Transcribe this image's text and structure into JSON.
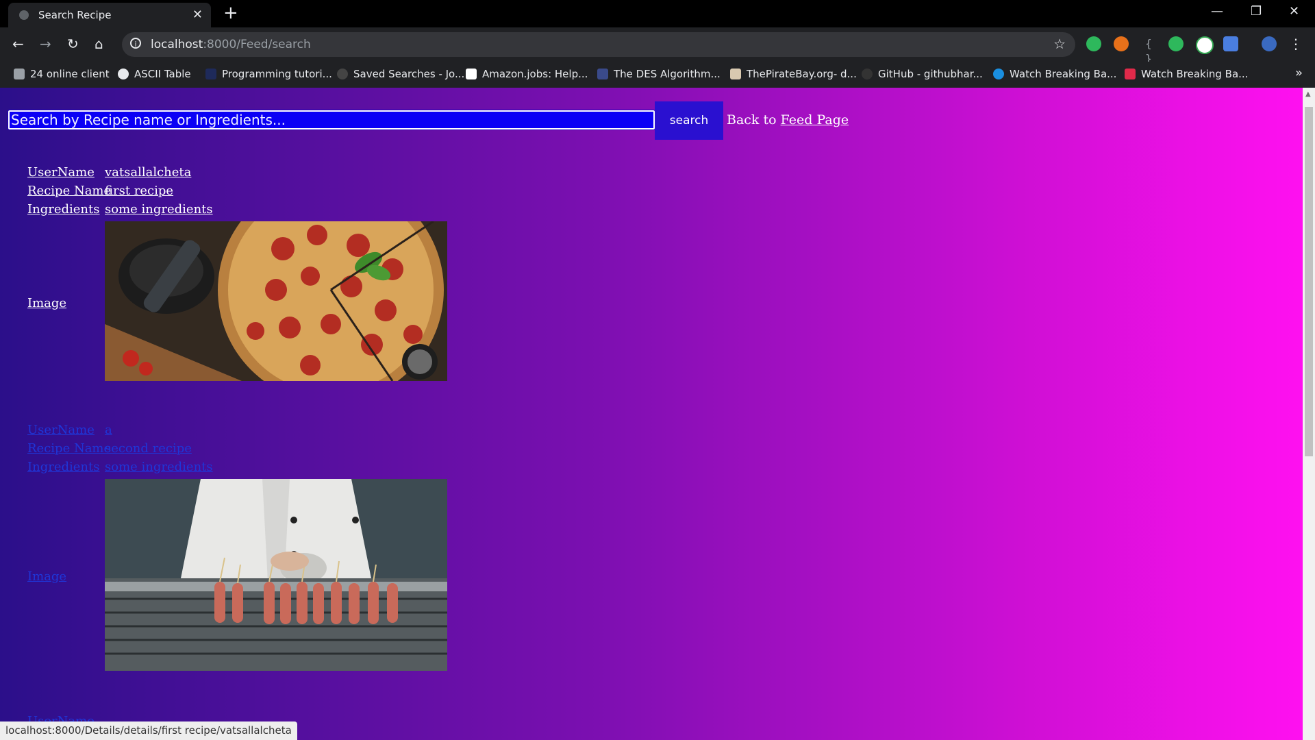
{
  "browser": {
    "tab_title": "Search Recipe",
    "new_tab": "+",
    "url_host": "localhost",
    "url_rest": ":8000/Feed/search",
    "bookmarks": [
      {
        "label": "24 online client",
        "icon_color": "#9aa0a6"
      },
      {
        "label": "ASCII Table",
        "icon_color": "#e8eaed"
      },
      {
        "label": "Programming tutori...",
        "icon_color": "#1e2a5a"
      },
      {
        "label": "Saved Searches - Jo...",
        "icon_color": "#444444"
      },
      {
        "label": "Amazon.jobs: Help...",
        "icon_color": "#ffffff"
      },
      {
        "label": "The DES Algorithm...",
        "icon_color": "#3a4a8a"
      },
      {
        "label": "ThePirateBay.org- d...",
        "icon_color": "#d9c9b0"
      },
      {
        "label": "GitHub - githubhar...",
        "icon_color": "#333333"
      },
      {
        "label": "Watch Breaking Ba...",
        "icon_color": "#1a8fe0"
      },
      {
        "label": "Watch Breaking Ba...",
        "icon_color": "#e02a4a"
      }
    ],
    "status_url": "localhost:8000/Details/details/first recipe/vatsallalcheta"
  },
  "page": {
    "search_placeholder": "Search by Recipe name or Ingredients...",
    "search_button": "search",
    "back_prefix": "Back to",
    "back_link": "Feed Page"
  },
  "labels": {
    "username": "UserName",
    "recipe_name": "Recipe Name",
    "ingredients": "Ingredients",
    "image": "Image"
  },
  "recipes": [
    {
      "username": "vatsallalcheta",
      "recipe_name": "first recipe",
      "ingredients": "some ingredients",
      "image_desc": "pizza"
    },
    {
      "username": "a",
      "recipe_name": "second recipe",
      "ingredients": "some ingredients",
      "image_desc": "grill"
    }
  ],
  "colors": {
    "gradient_start": "#2b0f8a",
    "gradient_end": "#ff10f0",
    "visited_link": "#ffffff",
    "unvisited_link": "#1f36d8"
  }
}
